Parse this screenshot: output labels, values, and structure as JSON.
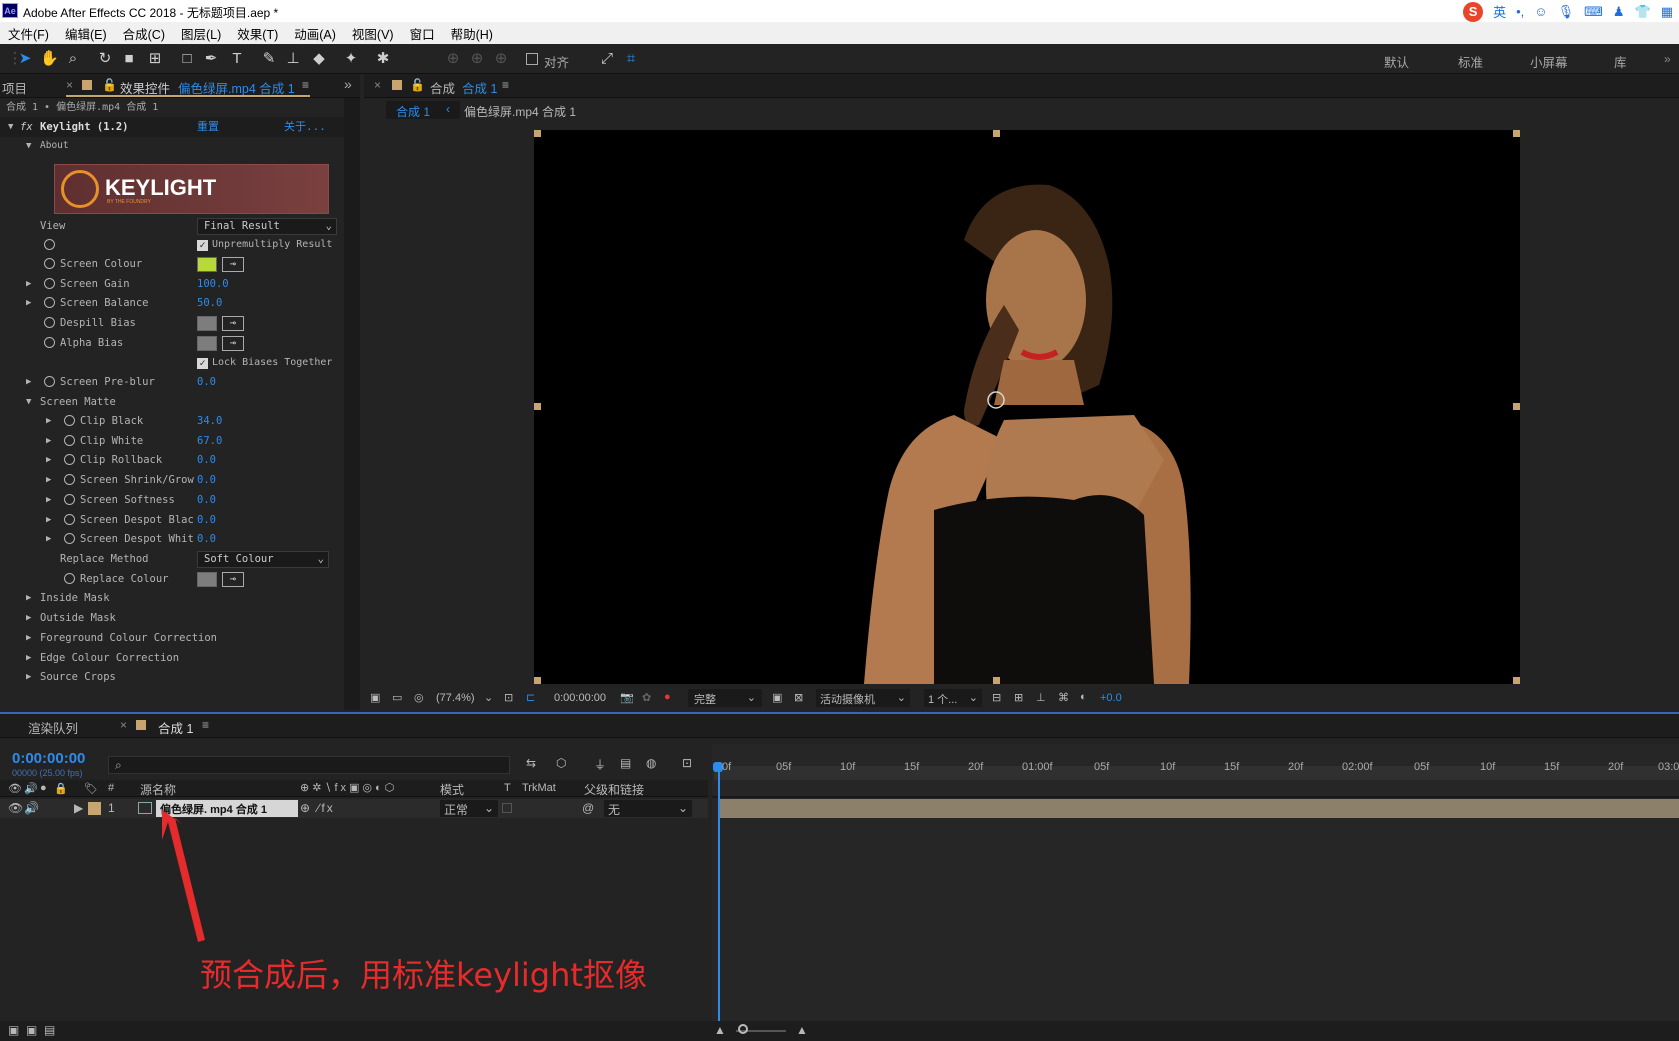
{
  "window": {
    "title": "Adobe After Effects CC 2018 - 无标题项目.aep *",
    "app_icon": "Ae"
  },
  "ime": {
    "lang": "英",
    "logo": "S"
  },
  "menu": [
    "文件(F)",
    "编辑(E)",
    "合成(C)",
    "图层(L)",
    "效果(T)",
    "动画(A)",
    "视图(V)",
    "窗口",
    "帮助(H)"
  ],
  "toolbar": {
    "align_label": "对齐",
    "workspaces": [
      "默认",
      "标准",
      "小屏幕",
      "库"
    ]
  },
  "effects_panel": {
    "project_tab": "项目",
    "tab_prefix": "效果控件",
    "tab_layer": "偏色绿屏.mp4 合成 1",
    "breadcrumb": "合成 1 • 偏色绿屏.mp4 合成 1",
    "effect_name": "Keylight (1.2)",
    "reset": "重置",
    "about_link": "关于...",
    "about_label": "About",
    "logo_text": "KEYLIGHT",
    "logo_sub": "BY THE FOUNDRY",
    "view_label": "View",
    "view_value": "Final Result",
    "unpremultiply": "Unpremultiply Result",
    "screen_colour_label": "Screen Colour",
    "screen_colour": "#b8d93a",
    "screen_gain_label": "Screen Gain",
    "screen_gain": "100.0",
    "screen_balance_label": "Screen Balance",
    "screen_balance": "50.0",
    "despill_label": "Despill Bias",
    "alpha_bias_label": "Alpha Bias",
    "lock_biases": "Lock Biases Together",
    "preblur_label": "Screen Pre-blur",
    "preblur": "0.0",
    "matte_label": "Screen Matte",
    "clip_black_label": "Clip Black",
    "clip_black": "34.0",
    "clip_white_label": "Clip White",
    "clip_white": "67.0",
    "clip_rollback_label": "Clip Rollback",
    "clip_rollback": "0.0",
    "shrink_label": "Screen Shrink/Grow",
    "shrink": "0.0",
    "softness_label": "Screen Softness",
    "softness": "0.0",
    "despot_black_label": "Screen Despot Blac",
    "despot_black": "0.0",
    "despot_white_label": "Screen Despot Whit",
    "despot_white": "0.0",
    "replace_method_label": "Replace Method",
    "replace_method": "Soft Colour",
    "replace_colour_label": "Replace Colour",
    "groups": [
      "Inside Mask",
      "Outside Mask",
      "Foreground Colour Correction",
      "Edge Colour Correction",
      "Source Crops"
    ]
  },
  "viewer": {
    "tab_label": "合成",
    "tab_comp": "合成 1",
    "crumb_active": "合成 1",
    "crumb_2": "偏色绿屏.mp4 合成 1",
    "zoom": "(77.4%)",
    "timecode": "0:00:00:00",
    "resolution": "完整",
    "camera": "活动摄像机",
    "views": "1 个...",
    "exposure": "+0.0"
  },
  "timeline": {
    "render_queue": "渲染队列",
    "comp_tab": "合成 1",
    "timecode": "0:00:00:00",
    "fps": "00000 (25.00 fps)",
    "col_num": "#",
    "col_source": "源名称",
    "col_mode": "模式",
    "col_t": "T",
    "col_trkmat": "TrkMat",
    "col_parent": "父级和链接",
    "layer_num": "1",
    "layer_name": "偏色绿屏. mp4 合成 1",
    "layer_mode": "正常",
    "layer_parent": "无",
    "ruler": [
      "0f",
      "05f",
      "10f",
      "15f",
      "20f",
      "01:00f",
      "05f",
      "10f",
      "15f",
      "20f",
      "02:00f",
      "05f",
      "10f",
      "15f",
      "20f",
      "03:0"
    ]
  },
  "annotation": "预合成后，用标准keylight抠像",
  "colors": {
    "accent": "#2d8ceb",
    "annotation": "#e52b2b",
    "layer_label": "#c8a46e"
  }
}
